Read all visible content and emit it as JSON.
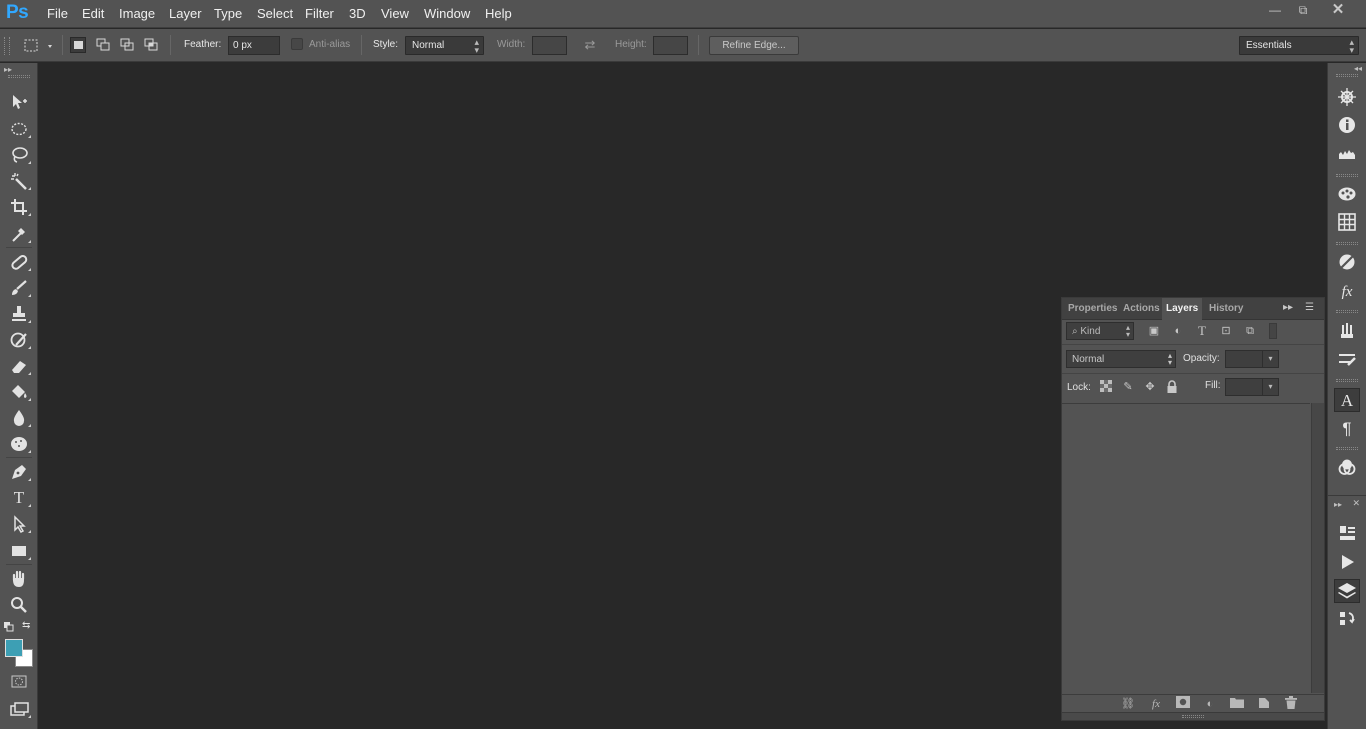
{
  "app": {
    "logo": "Ps",
    "menu": [
      "File",
      "Edit",
      "Image",
      "Layer",
      "Type",
      "Select",
      "Filter",
      "3D",
      "View",
      "Window",
      "Help"
    ],
    "window_controls": {
      "minimize": "—",
      "restore": "⧉",
      "close": "✕"
    }
  },
  "options_bar": {
    "feather_label": "Feather:",
    "feather_value": "0 px",
    "antialias_label": "Anti-alias",
    "style_label": "Style:",
    "style_value": "Normal",
    "width_label": "Width:",
    "width_value": "",
    "height_label": "Height:",
    "height_value": "",
    "refine_edge_label": "Refine Edge...",
    "workspace_value": "Essentials"
  },
  "toolbar": {
    "tools": [
      {
        "name": "move-tool",
        "icon": "move-icon"
      },
      {
        "name": "marquee-tool",
        "icon": "elliptical-marquee-icon"
      },
      {
        "name": "lasso-tool",
        "icon": "lasso-icon"
      },
      {
        "name": "magic-wand-tool",
        "icon": "magic-wand-icon"
      },
      {
        "name": "crop-tool",
        "icon": "crop-icon"
      },
      {
        "name": "eyedropper-tool",
        "icon": "eyedropper-icon"
      },
      {
        "name": "healing-brush-tool",
        "icon": "bandage-icon"
      },
      {
        "name": "brush-tool",
        "icon": "brush-icon"
      },
      {
        "name": "clone-stamp-tool",
        "icon": "stamp-icon"
      },
      {
        "name": "history-brush-tool",
        "icon": "history-brush-icon"
      },
      {
        "name": "eraser-tool",
        "icon": "eraser-icon"
      },
      {
        "name": "paint-bucket-tool",
        "icon": "paint-bucket-icon"
      },
      {
        "name": "blur-tool",
        "icon": "drop-icon"
      },
      {
        "name": "sponge-tool",
        "icon": "sponge-icon"
      },
      {
        "name": "pen-tool",
        "icon": "pen-icon"
      },
      {
        "name": "type-tool",
        "icon": "type-icon"
      },
      {
        "name": "path-selection-tool",
        "icon": "arrow-icon"
      },
      {
        "name": "rectangle-tool",
        "icon": "rectangle-icon"
      },
      {
        "name": "hand-tool",
        "icon": "hand-icon"
      },
      {
        "name": "zoom-tool",
        "icon": "zoom-icon"
      }
    ],
    "foreground_color": "#3d9fb4",
    "background_color": "#ffffff"
  },
  "right_dock": {
    "icons": [
      "navigator-icon",
      "info-icon",
      "histogram-icon",
      "color-icon",
      "swatches-icon",
      "adjustments-icon",
      "styles-icon",
      "brush-presets-icon",
      "brush-icon",
      "character-icon",
      "paragraph-icon",
      "channels-icon",
      "properties-icon",
      "actions-icon",
      "layers-icon",
      "history-icon"
    ]
  },
  "layers_panel": {
    "tabs": [
      "Properties",
      "Actions",
      "Layers",
      "History"
    ],
    "active_tab": "Layers",
    "filter_kind": "Kind",
    "blend_mode": "Normal",
    "opacity_label": "Opacity:",
    "opacity_value": "",
    "lock_label": "Lock:",
    "fill_label": "Fill:",
    "fill_value": ""
  }
}
